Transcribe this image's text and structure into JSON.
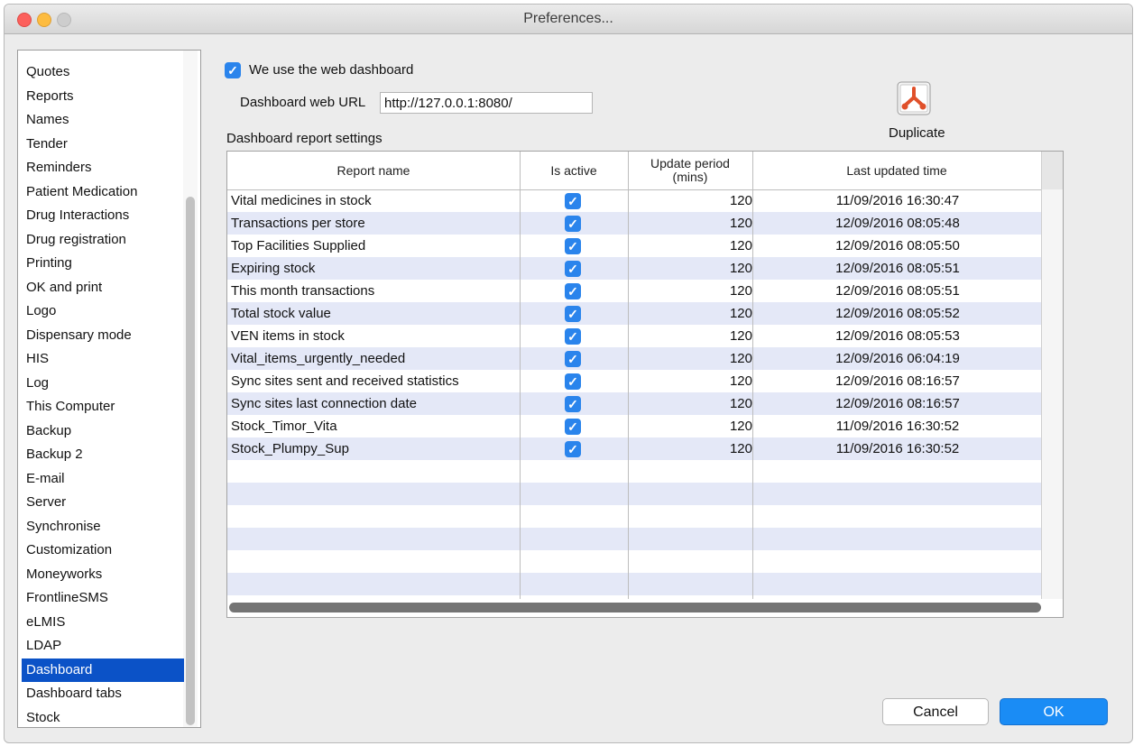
{
  "window": {
    "title": "Preferences..."
  },
  "sidebar": {
    "items": [
      "Quotes",
      "Reports",
      "Names",
      "Tender",
      "Reminders",
      "Patient Medication",
      "Drug Interactions",
      "Drug registration",
      "Printing",
      "OK and print",
      "Logo",
      "Dispensary mode",
      "HIS",
      "Log",
      "This Computer",
      "Backup",
      "Backup 2",
      "E-mail",
      "Server",
      "Synchronise",
      "Customization",
      "Moneyworks",
      "FrontlineSMS",
      "eLMIS",
      "LDAP",
      "Dashboard",
      "Dashboard tabs",
      "Stock"
    ],
    "selected": "Dashboard"
  },
  "dashboard": {
    "use_web_dashboard_label": "We use the web dashboard",
    "use_web_dashboard_checked": true,
    "url_label": "Dashboard web URL",
    "url_value": "http://127.0.0.1:8080/",
    "settings_label": "Dashboard report settings",
    "duplicate_label": "Duplicate",
    "duplicate_icon": "duplicate-report-icon"
  },
  "table": {
    "columns": {
      "name": "Report name",
      "active": "Is active",
      "period_line1": "Update period",
      "period_line2": "(mins)",
      "updated": "Last updated time"
    },
    "rows": [
      {
        "name": "Vital medicines in stock",
        "active": true,
        "period": "120",
        "updated": "11/09/2016 16:30:47"
      },
      {
        "name": "Transactions per store",
        "active": true,
        "period": "120",
        "updated": "12/09/2016 08:05:48"
      },
      {
        "name": "Top Facilities Supplied",
        "active": true,
        "period": "120",
        "updated": "12/09/2016 08:05:50"
      },
      {
        "name": "Expiring stock",
        "active": true,
        "period": "120",
        "updated": "12/09/2016 08:05:51"
      },
      {
        "name": "This month transactions",
        "active": true,
        "period": "120",
        "updated": "12/09/2016 08:05:51"
      },
      {
        "name": "Total stock value",
        "active": true,
        "period": "120",
        "updated": "12/09/2016 08:05:52"
      },
      {
        "name": "VEN items in stock",
        "active": true,
        "period": "120",
        "updated": "12/09/2016 08:05:53"
      },
      {
        "name": "Vital_items_urgently_needed",
        "active": true,
        "period": "120",
        "updated": "12/09/2016 06:04:19"
      },
      {
        "name": "Sync sites sent and received statistics",
        "active": true,
        "period": "120",
        "updated": "12/09/2016 08:16:57"
      },
      {
        "name": "Sync sites last connection date",
        "active": true,
        "period": "120",
        "updated": "12/09/2016 08:16:57"
      },
      {
        "name": "Stock_Timor_Vita",
        "active": true,
        "period": "120",
        "updated": "11/09/2016 16:30:52"
      },
      {
        "name": "Stock_Plumpy_Sup",
        "active": true,
        "period": "120",
        "updated": "11/09/2016 16:30:52"
      }
    ]
  },
  "buttons": {
    "cancel": "Cancel",
    "ok": "OK"
  },
  "colors": {
    "selection": "#0b52c7",
    "checkbox": "#2a84ec",
    "row_alt": "#e4e8f7",
    "ok_button": "#1a8cf5"
  }
}
